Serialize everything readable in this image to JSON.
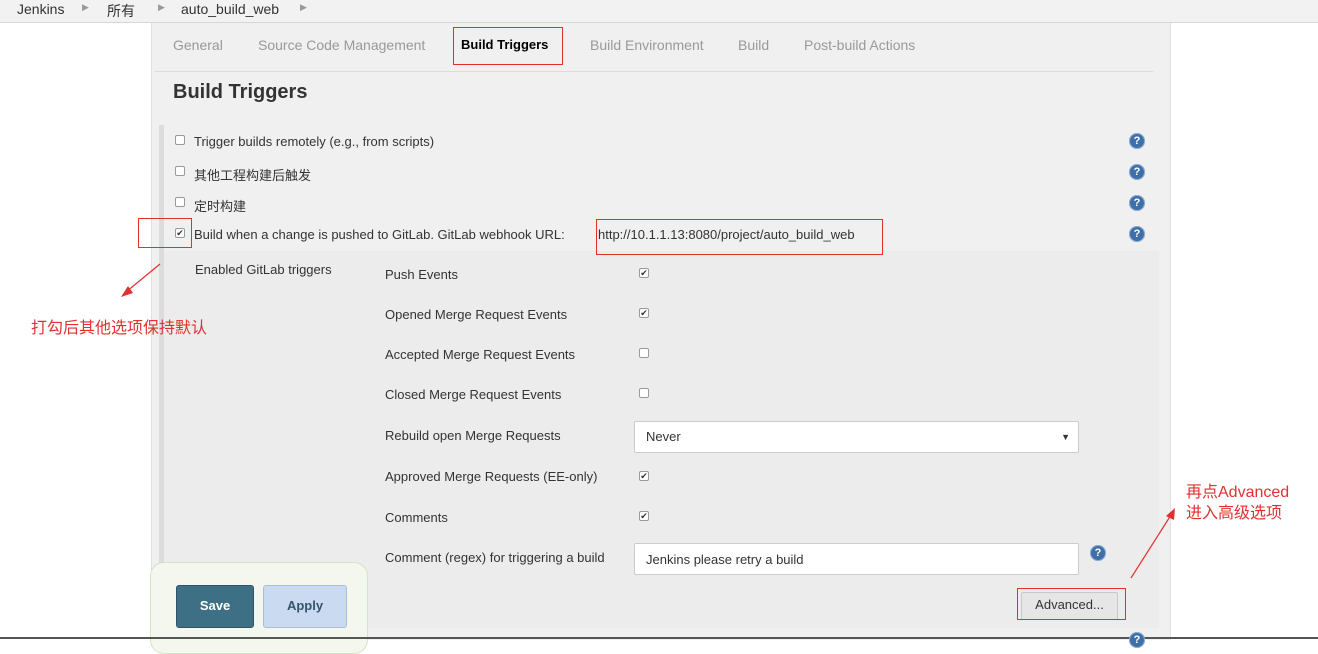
{
  "breadcrumb": {
    "items": [
      "Jenkins",
      "所有",
      "auto_build_web"
    ]
  },
  "tabs": [
    {
      "label": "General"
    },
    {
      "label": "Source Code Management"
    },
    {
      "label": "Build Triggers",
      "active": true
    },
    {
      "label": "Build Environment"
    },
    {
      "label": "Build"
    },
    {
      "label": "Post-build Actions"
    }
  ],
  "section": {
    "title": "Build Triggers"
  },
  "triggers": [
    {
      "label": "Trigger builds remotely (e.g., from scripts)",
      "checked": false
    },
    {
      "label": "其他工程构建后触发",
      "checked": false
    },
    {
      "label": "定时构建",
      "checked": false
    },
    {
      "label": "Build when a change is pushed to GitLab. GitLab webhook URL:",
      "checked": true,
      "url": "http://10.1.1.13:8080/project/auto_build_web"
    }
  ],
  "gitlab": {
    "heading": "Enabled GitLab triggers",
    "events": [
      {
        "label": "Push Events",
        "checked": true
      },
      {
        "label": "Opened Merge Request Events",
        "checked": true
      },
      {
        "label": "Accepted Merge Request Events",
        "checked": false
      },
      {
        "label": "Closed Merge Request Events",
        "checked": false
      }
    ],
    "rebuild": {
      "label": "Rebuild open Merge Requests",
      "value": "Never"
    },
    "approved": {
      "label": "Approved Merge Requests (EE-only)",
      "checked": true
    },
    "comments": {
      "label": "Comments",
      "checked": true
    },
    "comment_regex": {
      "label": "Comment (regex) for triggering a build",
      "value": "Jenkins please retry a build"
    },
    "advanced_label": "Advanced..."
  },
  "buttons": {
    "save": "Save",
    "apply": "Apply"
  },
  "annotations": {
    "left_note": "打勾后其他选项保持默认",
    "right_note_line1": "再点Advanced",
    "right_note_line2": "进入高级选项",
    "color": "#e03131"
  },
  "icons": {
    "help": "help-icon",
    "check": "check-icon"
  }
}
